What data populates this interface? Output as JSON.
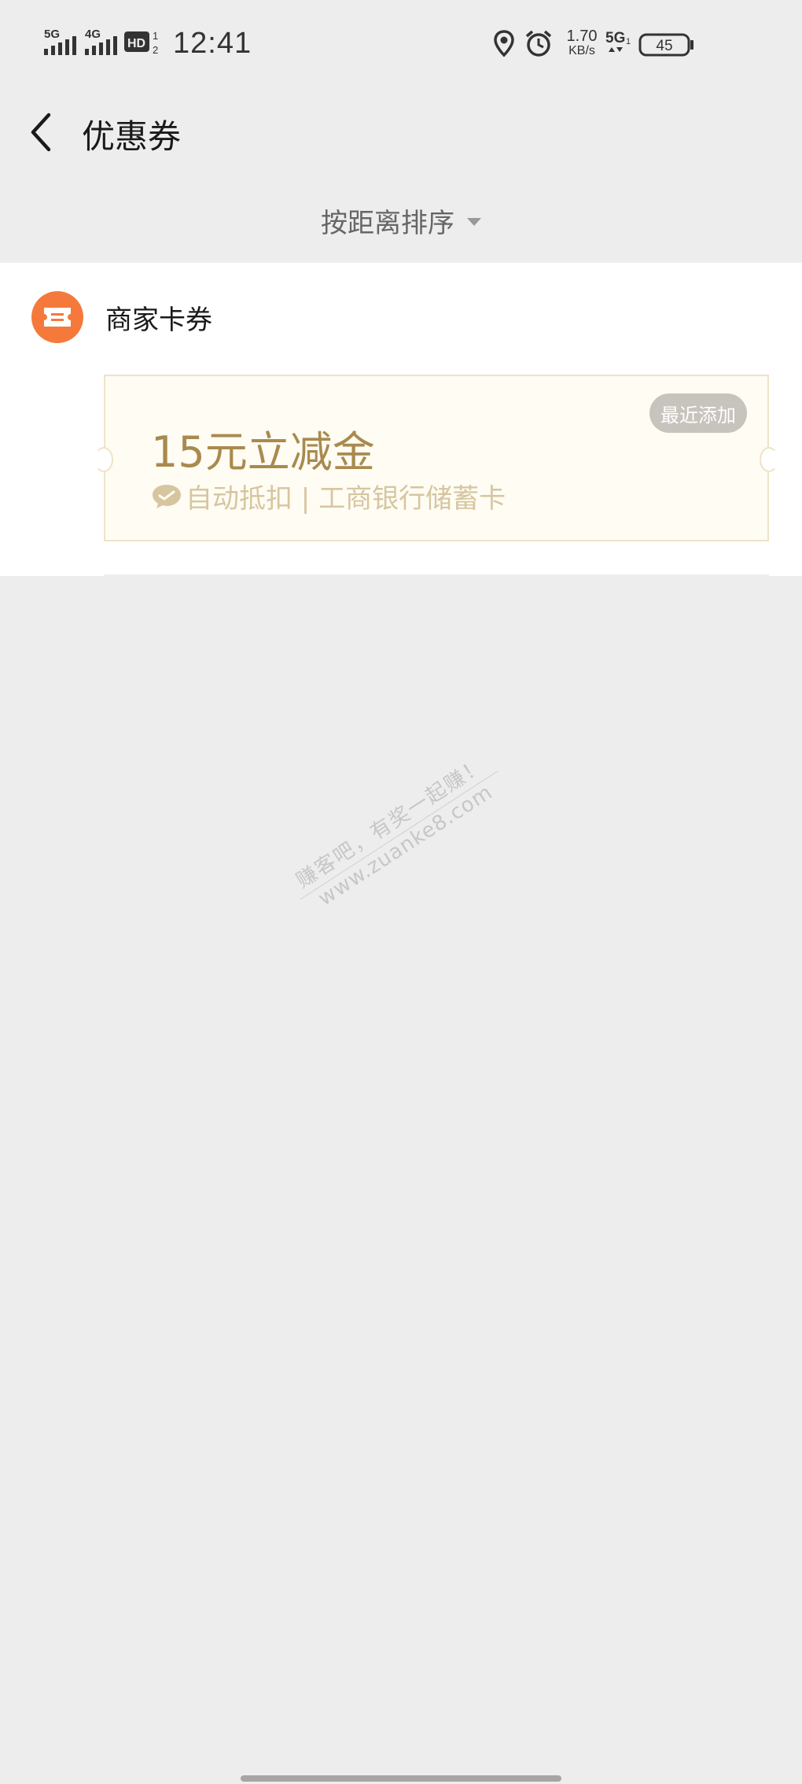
{
  "status_bar": {
    "signal1_label": "5G",
    "signal2_label": "4G",
    "hd_label": "HD",
    "hd_sup": "1",
    "hd_sub": "2",
    "time": "12:41",
    "net_speed_value": "1.70",
    "net_speed_unit": "KB/s",
    "network_type": "5G",
    "network_sub": "1",
    "battery_level": "45"
  },
  "nav": {
    "title": "优惠券"
  },
  "sort": {
    "label": "按距离排序"
  },
  "section": {
    "title": "商家卡券",
    "icon_color": "#f5793b"
  },
  "coupon": {
    "amount_text": "15元立减金",
    "description": "自动抵扣 | 工商银行储蓄卡",
    "badge": "最近添加",
    "title_color": "#a98a4e"
  },
  "watermark": {
    "line1": "赚客吧，有奖一起赚！",
    "line2": "www.zuanke8.com"
  }
}
